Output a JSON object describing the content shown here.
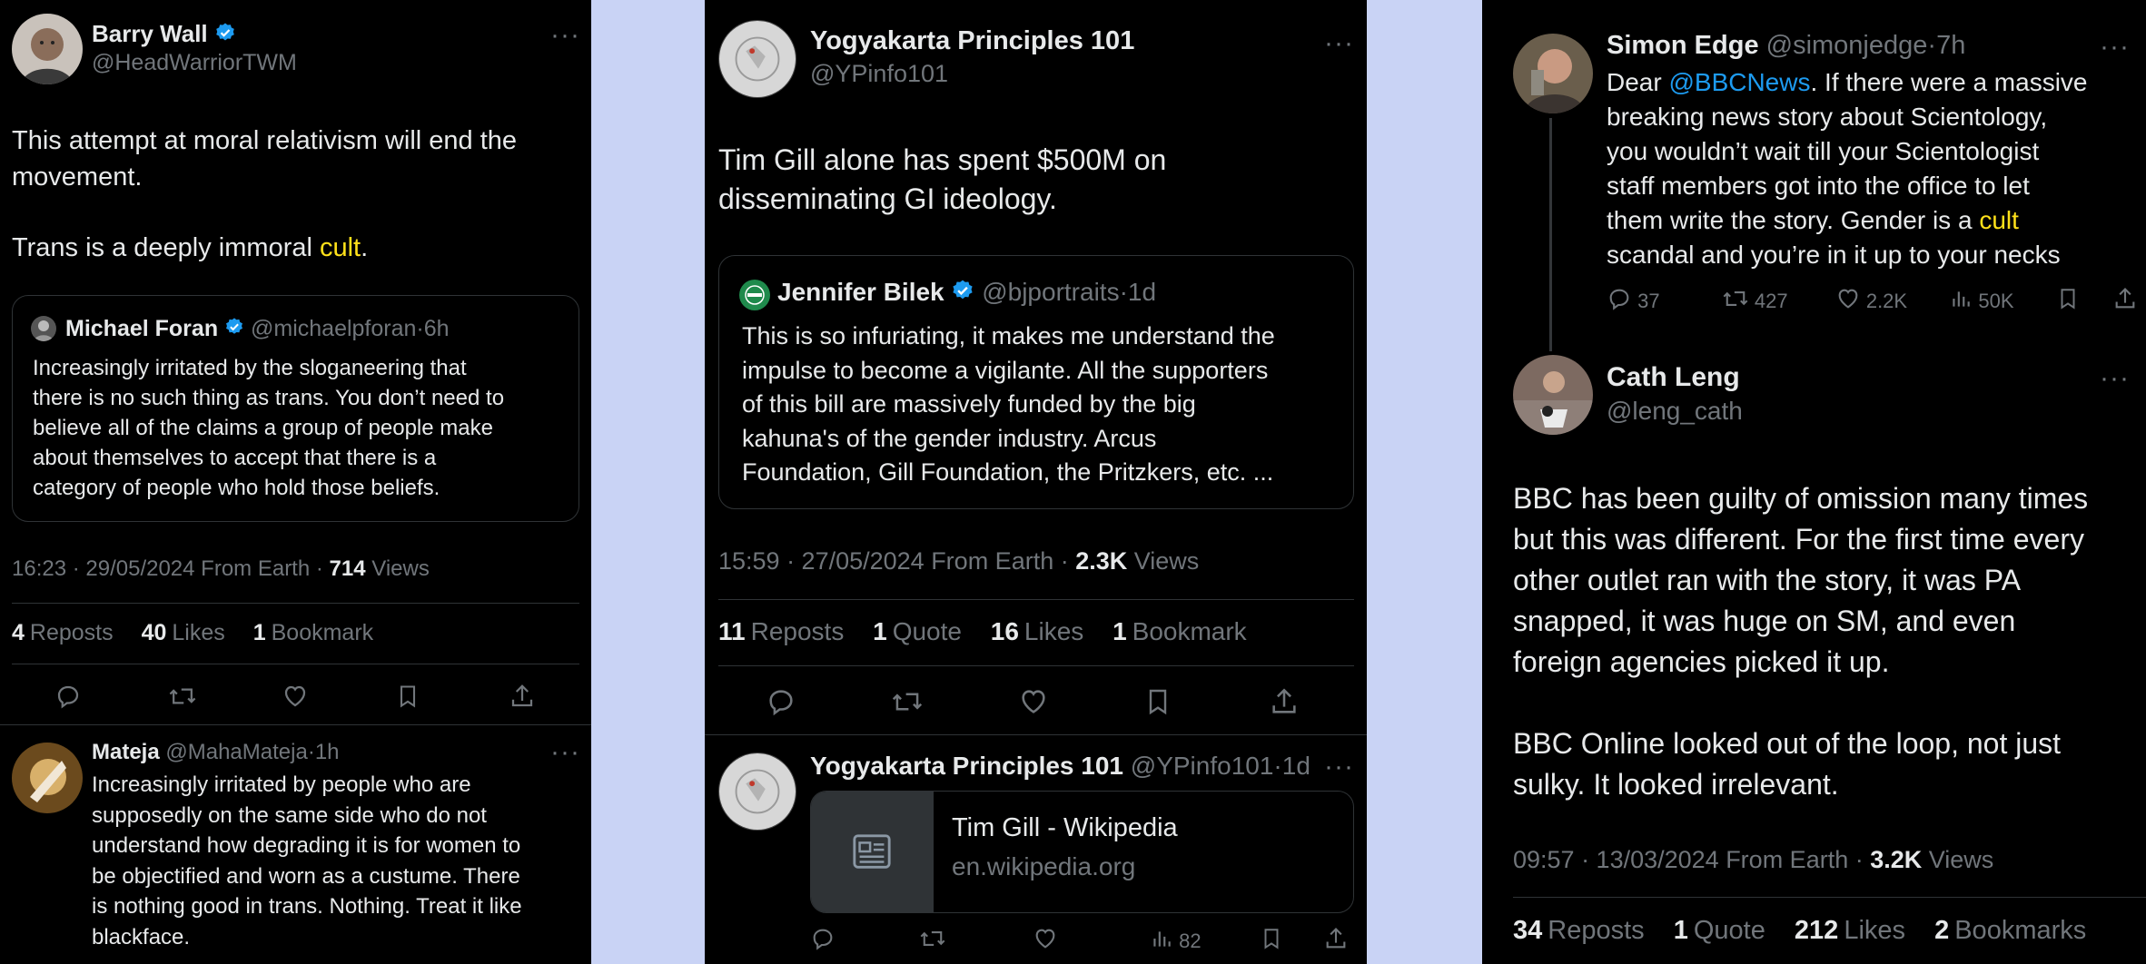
{
  "panel1": {
    "main": {
      "name": "Barry Wall",
      "handle": "@HeadWarriorTWM",
      "text_line1": "This attempt at moral relativism will end the",
      "text_line2": "movement.",
      "text_para2_pre": "Trans is a deeply immoral ",
      "text_para2_hl": "cult",
      "text_para2_post": "."
    },
    "quote": {
      "name": "Michael Foran",
      "handle": "@michaelpforan",
      "sep": "·",
      "time": "6h",
      "text": "Increasingly irritated by the sloganeering that\nthere is no such thing as trans. You don’t need to\nbelieve all of the claims a group of people make\nabout themselves to accept that there is a\ncategory of people who hold those beliefs."
    },
    "meta": {
      "time_date": "16:23 · 29/05/2024 From Earth · ",
      "views_count": "714",
      "views_label": " Views"
    },
    "stats": {
      "reposts_n": "4",
      "reposts_l": "Reposts",
      "likes_n": "40",
      "likes_l": "Likes",
      "bookmarks_n": "1",
      "bookmarks_l": "Bookmark"
    },
    "reply": {
      "name": "Mateja",
      "handle": "@MahaMateja",
      "sep": "·",
      "time": "1h",
      "text": "Increasingly irritated by people who are\nsupposedly on the same side who do not\nunderstand how degrading it is for women to\nbe objectified and worn as a custume. There\nis nothing good in trans. Nothing. Treat it like\nblackface."
    }
  },
  "panel2": {
    "main": {
      "name": "Yogyakarta Principles 101",
      "handle": "@YPinfo101",
      "text": "Tim Gill alone has spent $500M on\ndisseminating GI ideology."
    },
    "quote": {
      "name": "Jennifer Bilek",
      "handle": "@bjportraits",
      "sep": "·",
      "time": "1d",
      "text": "This is so infuriating, it makes me understand the\nimpulse to become a vigilante. All the supporters\nof this bill are massively funded by the big\nkahuna's of the gender industry. Arcus\nFoundation, Gill Foundation, the Pritzkers, etc. ..."
    },
    "meta": {
      "time_date": "15:59 · 27/05/2024 From Earth · ",
      "views_count": "2.3K",
      "views_label": " Views"
    },
    "stats": {
      "reposts_n": "11",
      "reposts_l": "Reposts",
      "quote_n": "1",
      "quote_l": "Quote",
      "likes_n": "16",
      "likes_l": "Likes",
      "bookmarks_n": "1",
      "bookmarks_l": "Bookmark"
    },
    "reply": {
      "name": "Yogyakarta Principles 101",
      "handle": "@YPinfo101",
      "sep": "·",
      "time": "1d",
      "card_title": "Tim Gill - Wikipedia",
      "card_domain": "en.wikipedia.org",
      "views": "82"
    }
  },
  "panel3": {
    "top": {
      "name": "Simon Edge",
      "handle": "@simonjedge",
      "sep": "·",
      "time": "7h",
      "text_dear": "Dear ",
      "mention": "@BBCNews",
      "text_rest": ". If there were a massive\nbreaking news story about Scientology,\nyou wouldn’t wait till your Scientologist\nstaff members got into the office to let\nthem write the story. Gender is a ",
      "hl": "cult",
      "text_end": "\nscandal and you’re in it up to your necks",
      "replies": "37",
      "reposts": "427",
      "likes": "2.2K",
      "views": "50K"
    },
    "main": {
      "name": "Cath Leng",
      "handle": "@leng_cath",
      "text": "BBC has been guilty of omission many times\nbut this was different. For the first time every\nother outlet ran with the story, it was PA\nsnapped, it was huge on SM, and even\nforeign agencies picked it up.\n\nBBC Online looked out of the loop, not just\nsulky.  It looked irrelevant."
    },
    "meta": {
      "time_date": "09:57 · 13/03/2024 From Earth · ",
      "views_count": "3.2K",
      "views_label": " Views"
    },
    "stats": {
      "reposts_n": "34",
      "reposts_l": "Reposts",
      "quote_n": "1",
      "quote_l": "Quote",
      "likes_n": "212",
      "likes_l": "Likes",
      "bookmarks_n": "2",
      "bookmarks_l": "Bookmarks"
    }
  },
  "colors": {
    "bg": "#000000",
    "text": "#e7e9ea",
    "muted": "#71767b",
    "link": "#1d9bf0",
    "highlight": "#ffe11a",
    "divider": "#2f3336",
    "gap": "#c9d3f5"
  },
  "icons": [
    "reply-icon",
    "repost-icon",
    "like-icon",
    "bookmark-icon",
    "share-icon",
    "views-icon",
    "verified-badge-icon",
    "more-icon",
    "article-icon"
  ]
}
